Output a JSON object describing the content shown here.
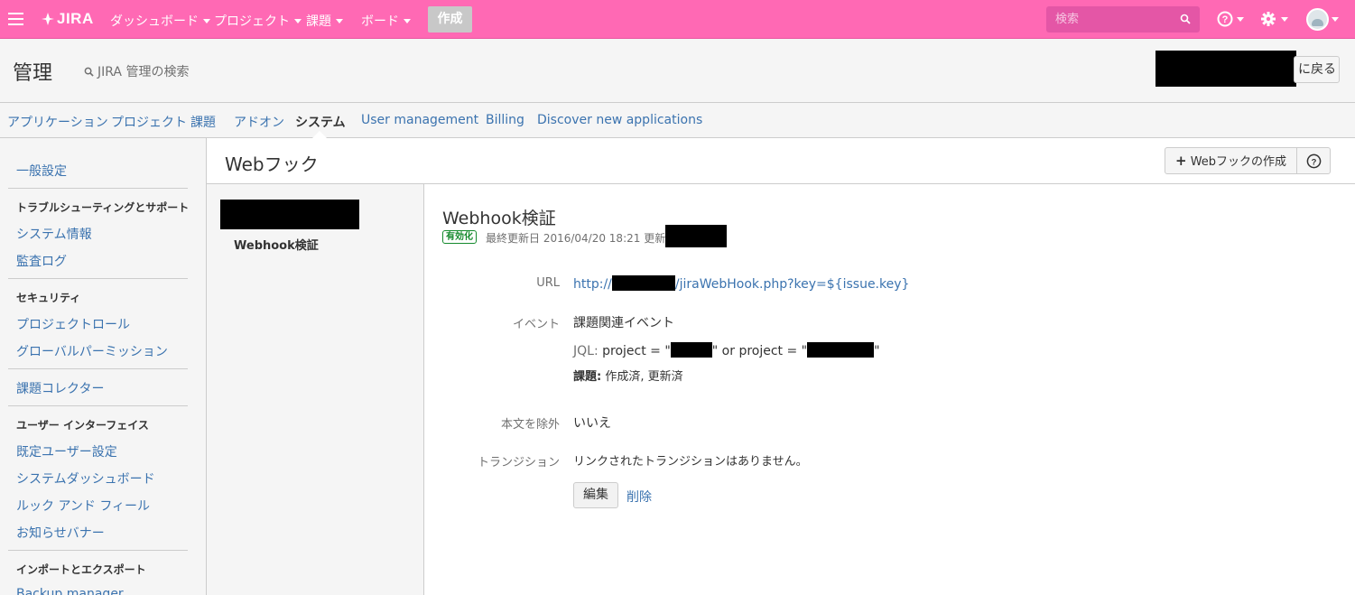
{
  "topbar": {
    "logo": "JIRA",
    "nav": [
      "ダッシュボード",
      "プロジェクト",
      "課題",
      "ボード"
    ],
    "create": "作成",
    "search_placeholder": "検索"
  },
  "admin": {
    "title": "管理",
    "search": "JIRA 管理の検索",
    "back": "に戻る"
  },
  "tabs": [
    "アプリケーション",
    "プロジェクト",
    "課題",
    "アドオン",
    "システム",
    "User management",
    "Billing",
    "Discover new applications"
  ],
  "sidebar": {
    "general": "一般設定",
    "h_trouble": "トラブルシューティングとサポート",
    "system_info": "システム情報",
    "audit_log": "監査ログ",
    "h_security": "セキュリティ",
    "project_roles": "プロジェクトロール",
    "global_perm": "グローバルパーミッション",
    "issue_collector": "課題コレクター",
    "h_ui": "ユーザー インターフェイス",
    "default_user": "既定ユーザー設定",
    "sys_dashboard": "システムダッシュボード",
    "look_feel": "ルック アンド フィール",
    "banner": "お知らせバナー",
    "h_import": "インポートとエクスポート",
    "backup": "Backup manager"
  },
  "main": {
    "title": "Webフック",
    "create_btn": "Webフックの作成",
    "list_item": "Webhook検証"
  },
  "detail": {
    "title": "Webhook検証",
    "status": "有効化",
    "meta": "最終更新日 2016/04/20 18:21 更新者",
    "url_label": "URL",
    "url_prefix": "http://",
    "url_suffix": "/jiraWebHook.php?key=${issue.key}",
    "event_label": "イベント",
    "event_value": "課題関連イベント",
    "jql_label": "JQL:",
    "jql_a": "project = \"",
    "jql_b": "\" or project = \"",
    "jql_c": "\"",
    "issue_label": "課題:",
    "issue_value": "作成済, 更新済",
    "exclude_label": "本文を除外",
    "exclude_value": "いいえ",
    "transition_label": "トランジション",
    "transition_value": "リンクされたトランジションはありません。",
    "edit": "編集",
    "delete": "削除"
  },
  "colors": {
    "topbar": "#ff69b4",
    "link": "#3b73af",
    "enabled": "#14892c"
  }
}
